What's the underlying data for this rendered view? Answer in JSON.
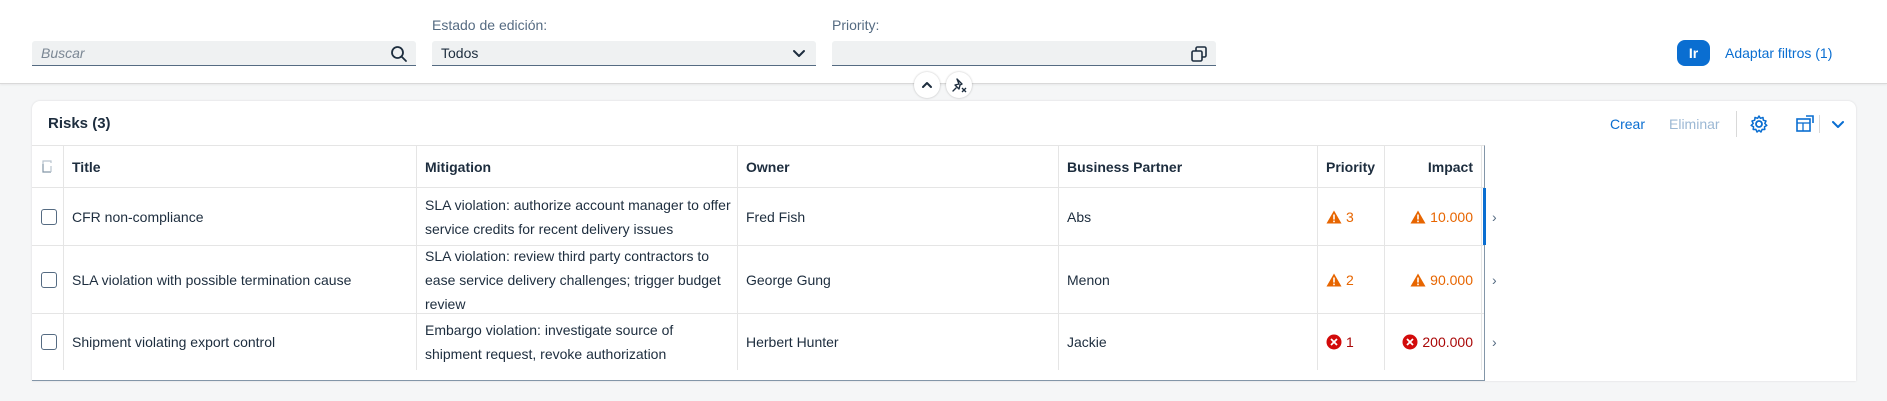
{
  "filters": {
    "search": {
      "placeholder": "Buscar"
    },
    "edit_state": {
      "label": "Estado de edición:",
      "value": "Todos"
    },
    "priority": {
      "label": "Priority:",
      "value": ""
    },
    "go_label": "Ir",
    "adapt_label": "Adaptar filtros (1)"
  },
  "table": {
    "title": "Risks (3)",
    "toolbar": {
      "create_label": "Crear",
      "delete_label": "Eliminar"
    },
    "columns": [
      "Title",
      "Mitigation",
      "Owner",
      "Business Partner",
      "Priority",
      "Impact"
    ],
    "rows": [
      {
        "title": "CFR non-compliance",
        "mitigation": "SLA violation: authorize account manager to offer service credits for recent delivery issues",
        "owner": "Fred Fish",
        "business_partner": "Abs",
        "priority": "3",
        "impact": "10.000",
        "criticality": "warning"
      },
      {
        "title": "SLA violation with possible termination cause",
        "mitigation": "SLA violation: review third party contractors to ease service delivery challenges; trigger budget review",
        "owner": "George Gung",
        "business_partner": "Menon",
        "priority": "2",
        "impact": "90.000",
        "criticality": "warning"
      },
      {
        "title": "Shipment violating export control",
        "mitigation": "Embargo violation: investigate source of shipment request, revoke authorization",
        "owner": "Herbert Hunter",
        "business_partner": "Jackie",
        "priority": "1",
        "impact": "200.000",
        "criticality": "error"
      }
    ]
  },
  "colors": {
    "accent": "#0a6ed1",
    "warning": "#e76500",
    "error": "#aa0808",
    "text": "#1d2d3e"
  },
  "icons": [
    "search-icon",
    "chevron-down-icon",
    "value-help-icon",
    "collapse-header-icon",
    "unpin-icon",
    "settings-icon",
    "export-icon",
    "warning-icon",
    "error-icon",
    "row-navigation-icon"
  ]
}
